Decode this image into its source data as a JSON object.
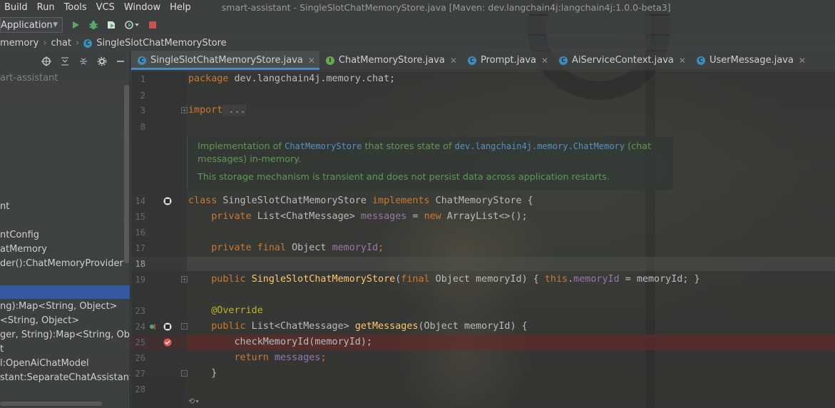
{
  "menu": {
    "items": [
      {
        "label": "Build"
      },
      {
        "label": "Run"
      },
      {
        "label": "Tools"
      },
      {
        "label": "VCS"
      },
      {
        "label": "Window"
      },
      {
        "label": "Help"
      }
    ],
    "window_title": "smart-assistant - SingleSlotChatMemoryStore.java [Maven: dev.langchain4j:langchain4j:1.0.0-beta3]"
  },
  "toolbar": {
    "run_config": "Application",
    "icons": [
      "run-icon",
      "debug-icon",
      "coverage-icon",
      "profile-icon",
      "stop-icon"
    ]
  },
  "breadcrumb": {
    "items": [
      "memory",
      "chat",
      "SingleSlotChatMemoryStore"
    ]
  },
  "project": {
    "rows": [
      {
        "text": "art-assistant",
        "dim": true
      },
      {
        "text": "nt"
      },
      {
        "text": "ntConfig"
      },
      {
        "text": "atMemory"
      },
      {
        "text": "der():ChatMemoryProvider"
      },
      {
        "text": "ng):Map<String, Object>"
      },
      {
        "text": "<String, Object>"
      },
      {
        "text": "ger, String):Map<String, Object"
      },
      {
        "text": "t"
      },
      {
        "text": "l:OpenAiChatModel"
      },
      {
        "text": "stant:SeparateChatAssistant"
      }
    ]
  },
  "tabs": [
    {
      "label": "SingleSlotChatMemoryStore.java",
      "kind": "class",
      "active": true
    },
    {
      "label": "ChatMemoryStore.java",
      "kind": "interface"
    },
    {
      "label": "Prompt.java",
      "kind": "class"
    },
    {
      "label": "AiServiceContext.java",
      "kind": "class"
    },
    {
      "label": "UserMessage.java",
      "kind": "class"
    }
  ],
  "editor": {
    "line_numbers": [
      "1",
      "2",
      "3",
      "8",
      "14",
      "15",
      "16",
      "17",
      "18",
      "19",
      "23",
      "24",
      "25",
      "26",
      "27",
      "28"
    ],
    "code": {
      "l1_kw": "package",
      "l1_rest": " dev.langchain4j.memory.chat;",
      "l3_kw": "import",
      "l3_rest": " ...",
      "l14_kw1": "class",
      "l14_mid": " SingleSlotChatMemoryStore ",
      "l14_kw2": "implements",
      "l14_rest": " ChatMemoryStore {",
      "l15_kw": "private",
      "l15_type": " List<ChatMessage> ",
      "l15_field": "messages",
      "l15_eq": " = ",
      "l15_new": "new",
      "l15_rest": " ArrayList<>();",
      "l17_kw1": "private",
      "l17_kw2": "final",
      "l17_type": " Object ",
      "l17_field": "memoryId",
      "l17_end": ";",
      "l19_kw": "public",
      "l19_fn": "SingleSlotChatMemoryStore",
      "l19_p1": "(",
      "l19_kw2": "final",
      "l19_p2": " Object memoryId) { ",
      "l19_this": "this",
      "l19_dot": ".",
      "l19_field": "memoryId",
      "l19_p3": " = memoryId; }",
      "l23_ann": "@Override",
      "l24_kw": "public",
      "l24_type": " List<ChatMessage> ",
      "l24_fn": "getMessages",
      "l24_rest": "(Object memoryId) {",
      "l25": "checkMemoryId(memoryId);",
      "l26_kw": "return",
      "l26_field": "messages",
      "l26_end": ";",
      "l27": "}"
    },
    "doc": {
      "p1_a": "Implementation of ",
      "p1_ref1": "ChatMemoryStore",
      "p1_b": " that stores state of ",
      "p1_ref2": "dev.langchain4j.memory.ChatMemory",
      "p1_c": " (chat messages) in-memory.",
      "p2": "This storage mechanism is transient and does not persist data across application restarts."
    }
  }
}
